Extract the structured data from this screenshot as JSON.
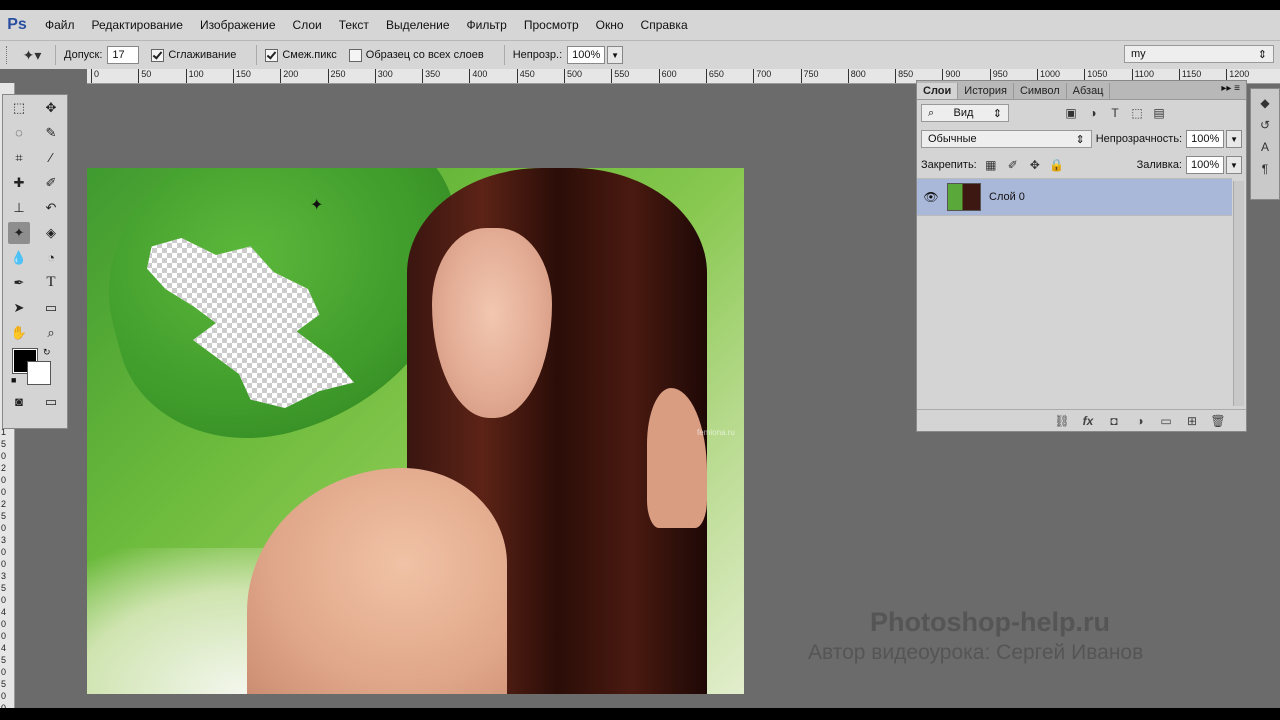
{
  "app": {
    "logo": "Ps"
  },
  "menu": [
    "Файл",
    "Редактирование",
    "Изображение",
    "Слои",
    "Текст",
    "Выделение",
    "Фильтр",
    "Просмотр",
    "Окно",
    "Справка"
  ],
  "options": {
    "tolerance_label": "Допуск:",
    "tolerance_value": "17",
    "antialias_label": "Сглаживание",
    "antialias_checked": true,
    "contiguous_label": "Смеж.пикс",
    "contiguous_checked": true,
    "sample_all_label": "Образец со всех слоев",
    "sample_all_checked": false,
    "opacity_label": "Непрозр.:",
    "opacity_value": "100%",
    "workspace_value": "my"
  },
  "ruler": {
    "h_ticks": [
      "0",
      "50",
      "100",
      "150",
      "200",
      "250",
      "300",
      "350",
      "400",
      "450",
      "500",
      "550",
      "600",
      "650",
      "700",
      "750",
      "800",
      "850",
      "900",
      "950",
      "1000",
      "1050",
      "1100",
      "1150",
      "1200"
    ],
    "v_ticks": [
      "1",
      "5",
      "0",
      "2",
      "0",
      "0",
      "2",
      "5",
      "0",
      "3",
      "0",
      "0",
      "3",
      "5",
      "0",
      "4",
      "0",
      "0",
      "4",
      "5",
      "0",
      "5",
      "0",
      "0"
    ]
  },
  "tools": {
    "colors": {
      "foreground": "#000000",
      "background": "#ffffff"
    }
  },
  "layers_panel": {
    "tabs": [
      "Слои",
      "История",
      "Символ",
      "Абзац"
    ],
    "active_tab": "Слои",
    "filter_label": "Вид",
    "blend_mode": "Обычные",
    "opacity_label": "Непрозрачность:",
    "opacity_value": "100%",
    "lock_label": "Закрепить:",
    "fill_label": "Заливка:",
    "fill_value": "100%",
    "layers": [
      {
        "name": "Слой 0",
        "visible": true,
        "selected": true
      }
    ]
  },
  "canvas": {
    "watermark": "femiona.ru"
  },
  "credits": {
    "site": "Photoshop-help.ru",
    "author": "Автор видеоурока: Сергей Иванов"
  }
}
